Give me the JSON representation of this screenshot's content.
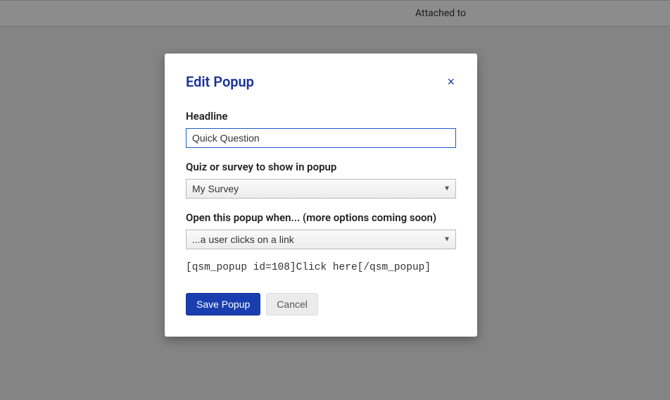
{
  "header": {
    "attached_label": "Attached to"
  },
  "modal": {
    "title": "Edit Popup",
    "close_symbol": "×",
    "headline_label": "Headline",
    "headline_value": "Quick Question",
    "quiz_label": "Quiz or survey to show in popup",
    "quiz_selected": "My Survey",
    "trigger_label": "Open this popup when... (more options coming soon)",
    "trigger_selected": "...a user clicks on a link",
    "shortcode": "[qsm_popup id=108]Click here[/qsm_popup]",
    "save_label": "Save Popup",
    "cancel_label": "Cancel"
  }
}
